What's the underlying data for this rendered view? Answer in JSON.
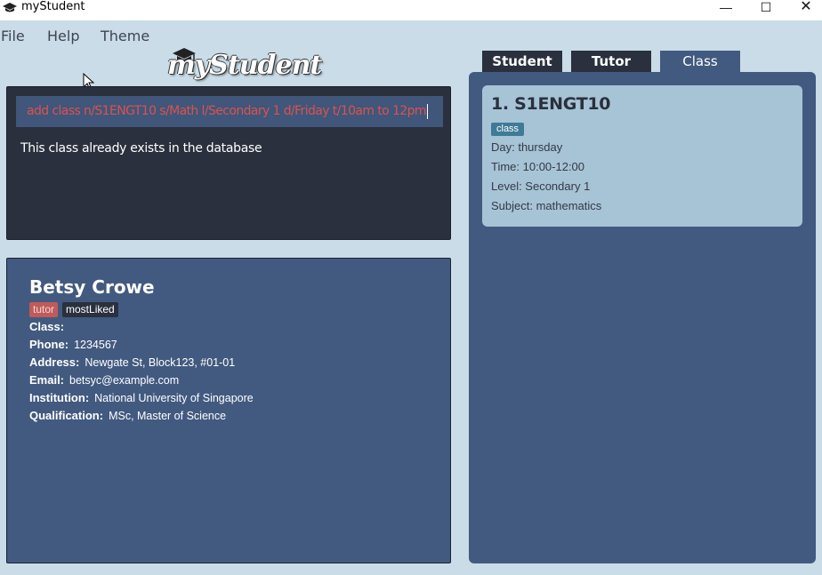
{
  "window": {
    "title": "myStudent",
    "icon": "graduation-cap-icon",
    "controls": {
      "minimize": "—",
      "maximize": "☐",
      "close": "✕"
    }
  },
  "menu": {
    "file": "File",
    "help": "Help",
    "theme": "Theme"
  },
  "logo": {
    "text": "myStudent"
  },
  "command": {
    "value": "add class n/S1ENGT10 s/Math l/Secondary 1 d/Friday t/10am to 12pm",
    "result": "This class already exists in the database"
  },
  "detail": {
    "name": "Betsy Crowe",
    "tags": [
      "tutor",
      "mostLiked"
    ],
    "fields": [
      {
        "label": "Class:",
        "value": ""
      },
      {
        "label": "Phone:",
        "value": "1234567"
      },
      {
        "label": "Address:",
        "value": "Newgate St, Block123, #01-01"
      },
      {
        "label": "Email:",
        "value": "betsyc@example.com"
      },
      {
        "label": "Institution:",
        "value": "National University of Singapore"
      },
      {
        "label": "Qualification:",
        "value": "MSc, Master of Science"
      }
    ]
  },
  "tabs": [
    {
      "label": "Student",
      "selected": false
    },
    {
      "label": "Tutor",
      "selected": false
    },
    {
      "label": "Class",
      "selected": true
    }
  ],
  "classes": [
    {
      "title": "1. S1ENGT10",
      "tag": "class",
      "day": "Day: thursday",
      "time": "Time: 10:00-12:00",
      "level": "Level: Secondary 1",
      "subject": "Subject: mathematics"
    }
  ],
  "colors": {
    "background": "#c9dce8",
    "dark_panel": "#2a303d",
    "blue_panel": "#425a80",
    "card": "#a7c3d6",
    "error_text": "#d9534f",
    "tutor_tag": "#c15a5a",
    "class_tag": "#3f7a96"
  }
}
